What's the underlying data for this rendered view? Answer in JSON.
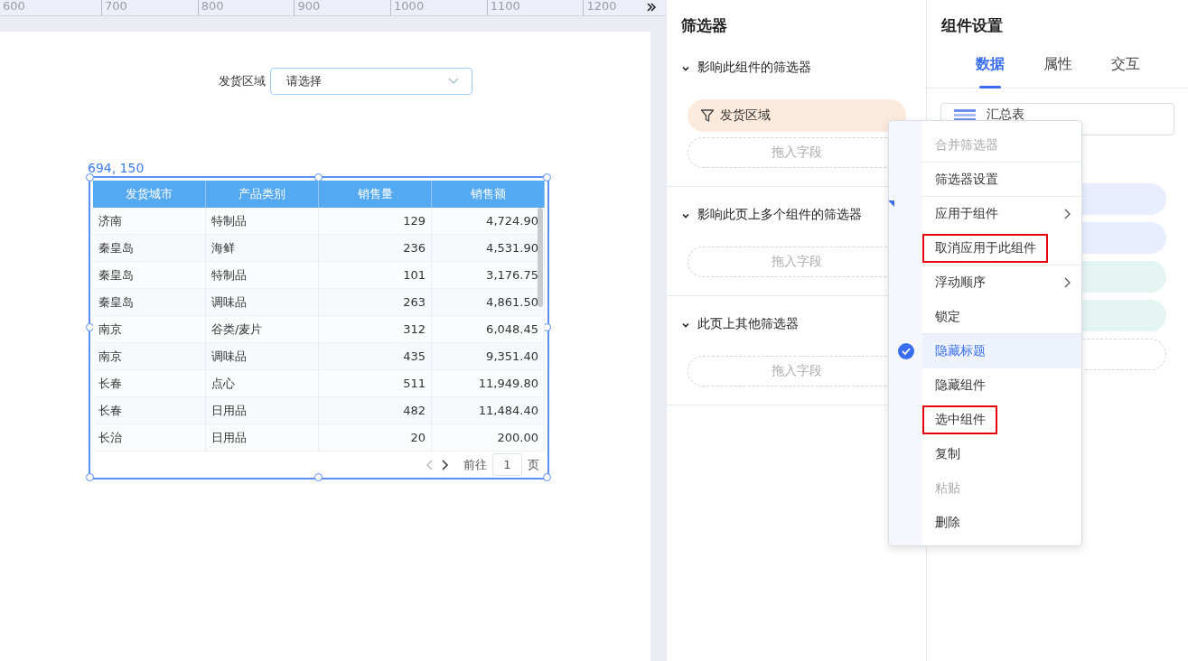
{
  "ruler": {
    "labels": [
      "600",
      "700",
      "800",
      "900",
      "1000",
      "1100",
      "1200"
    ]
  },
  "canvas": {
    "filter": {
      "label": "发货区域",
      "placeholder": "请选择"
    },
    "widget": {
      "selected": true,
      "position": "694, 150",
      "columns": [
        "发货城市",
        "产品类别",
        "销售量",
        "销售额"
      ],
      "rows": [
        [
          "济南",
          "特制品",
          "129",
          "4,724.90"
        ],
        [
          "秦皇岛",
          "海鲜",
          "236",
          "4,531.90"
        ],
        [
          "秦皇岛",
          "特制品",
          "101",
          "3,176.75"
        ],
        [
          "秦皇岛",
          "调味品",
          "263",
          "4,861.50"
        ],
        [
          "南京",
          "谷类/麦片",
          "312",
          "6,048.45"
        ],
        [
          "南京",
          "调味品",
          "435",
          "9,351.40"
        ],
        [
          "长春",
          "点心",
          "511",
          "11,949.80"
        ],
        [
          "长春",
          "日用品",
          "482",
          "11,484.40"
        ],
        [
          "长治",
          "日用品",
          "20",
          "200.00"
        ]
      ],
      "pagination": {
        "prefix": "前往",
        "page": "1",
        "suffix": "页"
      }
    }
  },
  "filter_panel": {
    "title": "筛选器",
    "sections": [
      {
        "title": "影响此组件的筛选器",
        "expanded": true,
        "filters": [
          "发货区域"
        ],
        "drop_zone": "拖入字段"
      },
      {
        "title": "影响此页上多个组件的筛选器",
        "expanded": true,
        "drop_zone": "拖入字段"
      },
      {
        "title": "此页上其他筛选器",
        "expanded": true,
        "drop_zone": "拖入字段"
      }
    ]
  },
  "settings_panel": {
    "title": "组件设置",
    "tabs": [
      {
        "label": "数据",
        "selected": true
      },
      {
        "label": "属性",
        "selected": false
      },
      {
        "label": "交互",
        "selected": false
      }
    ],
    "component": "汇总表",
    "fields": [
      {
        "color": "#e8eefd"
      },
      {
        "color": "#e8eefd"
      },
      {
        "color": "#e4f5f3"
      },
      {
        "color": "#e4f5f3"
      }
    ]
  },
  "context_menu": {
    "items": [
      {
        "label": "合并筛选器",
        "disabled": true,
        "checked": false,
        "boxed": false,
        "submenu": false,
        "divider_after": true
      },
      {
        "label": "筛选器设置",
        "disabled": false,
        "checked": false,
        "boxed": false,
        "submenu": false,
        "divider_after": true
      },
      {
        "label": "应用于组件",
        "disabled": false,
        "checked": false,
        "boxed": false,
        "submenu": true,
        "divider_after": false
      },
      {
        "label": "取消应用于此组件",
        "disabled": false,
        "checked": false,
        "boxed": true,
        "submenu": false,
        "divider_after": true
      },
      {
        "label": "浮动顺序",
        "disabled": false,
        "checked": false,
        "boxed": false,
        "submenu": true,
        "divider_after": false
      },
      {
        "label": "锁定",
        "disabled": false,
        "checked": false,
        "boxed": false,
        "submenu": false,
        "divider_after": true
      },
      {
        "label": "隐藏标题",
        "disabled": false,
        "checked": true,
        "boxed": false,
        "submenu": false,
        "divider_after": false
      },
      {
        "label": "隐藏组件",
        "disabled": false,
        "checked": false,
        "boxed": false,
        "submenu": false,
        "divider_after": false
      },
      {
        "label": "选中组件",
        "disabled": false,
        "checked": false,
        "boxed": true,
        "submenu": false,
        "divider_after": false
      },
      {
        "label": "复制",
        "disabled": false,
        "checked": false,
        "boxed": false,
        "submenu": false,
        "divider_after": false
      },
      {
        "label": "粘贴",
        "disabled": true,
        "checked": false,
        "boxed": false,
        "submenu": false,
        "divider_after": false
      },
      {
        "label": "删除",
        "disabled": false,
        "checked": false,
        "boxed": false,
        "submenu": false,
        "divider_after": false
      }
    ]
  }
}
